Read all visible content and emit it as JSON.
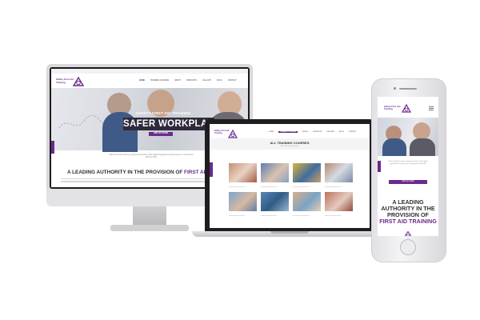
{
  "brand": {
    "logo_line1": "Safety First Aid",
    "logo_line2": "Training",
    "accent": "#6b2a8c",
    "dark": "#2f2a3b"
  },
  "desktop": {
    "nav": [
      "HOME",
      "TRAINING COURSES",
      "ABOUT",
      "PRODUCTS",
      "GALLERY",
      "BLOG",
      "CONTACT"
    ],
    "hero_subtitle": "SAFETY FIRST AID TRAINING",
    "hero_title": "SAFER WORKPLACES",
    "hero_button": "FIND OUT MORE",
    "blurb": "Safety First Aid Training is approved to deliver QCF Ofqual regulated first aid courses in accordance with the HSE.",
    "headline_main": "A LEADING AUTHORITY IN THE PROVISION OF ",
    "headline_highlight": "FIRST AID TRAINING"
  },
  "laptop": {
    "nav": [
      "HOME",
      "TRAINING COURSES",
      "ABOUT",
      "PRODUCTS",
      "GALLERY",
      "BLOG",
      "CONTACT"
    ],
    "page_title": "ALL TRAINING COURSES",
    "breadcrumb": "Home / All Training Courses",
    "courses": [
      {
        "caption": "FIRST AID AT WORK"
      },
      {
        "caption": "EMERGENCY FIRST AID"
      },
      {
        "caption": "PAEDIATRIC FIRST AID"
      },
      {
        "caption": "REQUALIFICATION"
      },
      {
        "caption": "BASIC LIFE SUPPORT"
      },
      {
        "caption": "ANAPHYLAXIS AWARENESS"
      },
      {
        "caption": "SCHOOLS FIRST AID"
      },
      {
        "caption": "AED DEFIBRILLATION"
      }
    ]
  },
  "phone": {
    "blurb": "Safety First Aid Training is approved to deliver QCF Ofqual regulated first aid courses in accordance with the HSE.",
    "button": "FIND OUT MORE",
    "headline_main": "A LEADING AUTHORITY IN THE PROVISION OF ",
    "headline_highlight": "FIRST AID TRAINING"
  }
}
